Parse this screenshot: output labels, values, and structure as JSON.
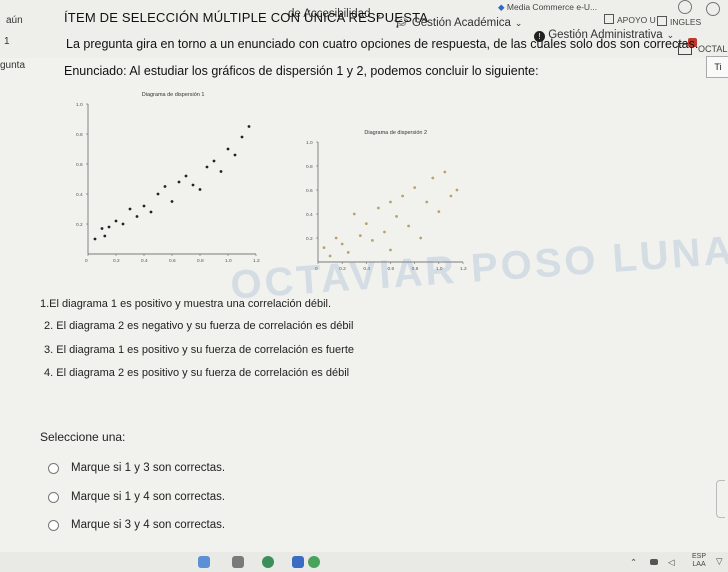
{
  "nav": {
    "accessibility": "de Accesibilidad",
    "academic": "Gestión Académica",
    "administrative": "Gestión Administrativa",
    "media_commerce": "Media Commerce e-U...",
    "apoyo": "APOYO U",
    "ingles": "INGLES",
    "octal": "OCTALI",
    "corner_letter": "Ti"
  },
  "left_col": {
    "status": "aún",
    "number": "1",
    "label": "gunta"
  },
  "question": {
    "type_title": "ÍTEM DE SELECCIÓN MÚLTIPLE CON ÚNICA RESPUESTA",
    "intro": "La pregunta gira en torno a un enunciado con cuatro opciones de respuesta, de las cuales solo dos son correctas.",
    "statement": "Enunciado: Al estudiar los gráficos de dispersión 1 y 2, podemos concluir lo siguiente:",
    "statements": [
      "1.El diagrama 1 es positivo y muestra una correlación débil.",
      "2. El diagrama 2 es negativo y su fuerza de correlación es débil",
      "3. El diagrama 1 es positivo y su fuerza de correlación es fuerte",
      "4. El diagrama 2 es positivo y su fuerza de correlación es débil"
    ],
    "select_prompt": "Seleccione una:",
    "answers": [
      "Marque si 1 y 3 son correctas.",
      "Marque si 1 y 4 son correctas.",
      "Marque si 3 y 4 son correctas."
    ]
  },
  "watermark": "OCTAVIAR POSO LUNA",
  "taskbar": {
    "lang": "ESP",
    "region": "LAA"
  },
  "chart_data": [
    {
      "type": "scatter",
      "title": "Diagrama de dispersión 1",
      "xlim": [
        0,
        1.2
      ],
      "ylim": [
        0,
        1.0
      ],
      "xticks": [
        "0",
        "0.2",
        "0.4",
        "0.6",
        "0.8",
        "1.0",
        "1.2"
      ],
      "yticks": [
        "0.2",
        "0.4",
        "0.6",
        "0.8",
        "1.0"
      ],
      "points": [
        [
          0.05,
          0.1
        ],
        [
          0.1,
          0.17
        ],
        [
          0.15,
          0.18
        ],
        [
          0.2,
          0.22
        ],
        [
          0.25,
          0.2
        ],
        [
          0.3,
          0.3
        ],
        [
          0.35,
          0.25
        ],
        [
          0.4,
          0.32
        ],
        [
          0.45,
          0.28
        ],
        [
          0.5,
          0.4
        ],
        [
          0.55,
          0.45
        ],
        [
          0.6,
          0.35
        ],
        [
          0.65,
          0.48
        ],
        [
          0.7,
          0.52
        ],
        [
          0.75,
          0.46
        ],
        [
          0.8,
          0.43
        ],
        [
          0.85,
          0.58
        ],
        [
          0.9,
          0.62
        ],
        [
          0.95,
          0.55
        ],
        [
          1.0,
          0.7
        ],
        [
          1.05,
          0.66
        ],
        [
          1.1,
          0.78
        ],
        [
          1.15,
          0.85
        ],
        [
          0.12,
          0.12
        ]
      ],
      "color": "#222222"
    },
    {
      "type": "scatter",
      "title": "Diagrama de dispersión 2",
      "xlim": [
        0,
        1.2
      ],
      "ylim": [
        0,
        1.0
      ],
      "xticks": [
        "0",
        "0.2",
        "0.4",
        "0.6",
        "0.8",
        "1.0",
        "1.2"
      ],
      "yticks": [
        "0.2",
        "0.4",
        "0.6",
        "0.8",
        "1.0"
      ],
      "points": [
        [
          0.05,
          0.12
        ],
        [
          0.1,
          0.05
        ],
        [
          0.15,
          0.2
        ],
        [
          0.2,
          0.15
        ],
        [
          0.25,
          0.08
        ],
        [
          0.3,
          0.4
        ],
        [
          0.35,
          0.22
        ],
        [
          0.4,
          0.32
        ],
        [
          0.45,
          0.18
        ],
        [
          0.5,
          0.45
        ],
        [
          0.55,
          0.25
        ],
        [
          0.6,
          0.5
        ],
        [
          0.65,
          0.38
        ],
        [
          0.7,
          0.55
        ],
        [
          0.75,
          0.3
        ],
        [
          0.8,
          0.62
        ],
        [
          0.85,
          0.2
        ],
        [
          0.9,
          0.5
        ],
        [
          0.95,
          0.7
        ],
        [
          1.0,
          0.42
        ],
        [
          1.05,
          0.75
        ],
        [
          1.1,
          0.55
        ],
        [
          1.15,
          0.6
        ],
        [
          0.6,
          0.1
        ]
      ],
      "color": "#b9a36a"
    }
  ]
}
